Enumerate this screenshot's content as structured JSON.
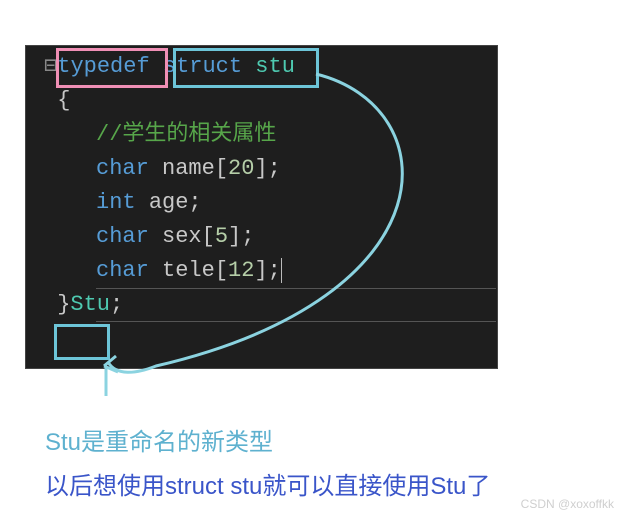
{
  "code": {
    "fold_marker": "⊟",
    "typedef": "typedef",
    "struct": "struct",
    "stu_type": "stu",
    "brace_open": "{",
    "brace_close": "}",
    "guide_char": "┊",
    "comment": "//学生的相关属性",
    "fields": [
      {
        "type": "char",
        "name": "name",
        "size": "20"
      },
      {
        "type": "int",
        "name": "age",
        "size": ""
      },
      {
        "type": "char",
        "name": "sex",
        "size": "5"
      },
      {
        "type": "char",
        "name": "tele",
        "size": "12"
      }
    ],
    "alias": "Stu",
    "semicolon": ";",
    "lbrace": "[",
    "rbrace": "]"
  },
  "annotations": {
    "line1": "Stu是重命名的新类型",
    "line2": "以后想使用struct stu就可以直接使用Stu了"
  },
  "watermark": "CSDN @xoxoffkk"
}
